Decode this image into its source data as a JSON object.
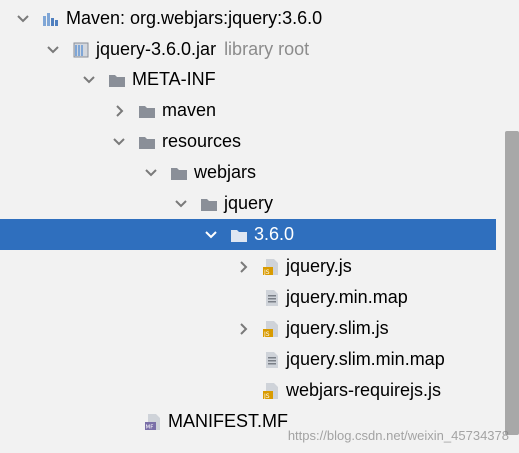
{
  "tree": {
    "items": [
      {
        "id": "maven-lib",
        "label": "Maven: org.webjars:jquery:3.6.0"
      },
      {
        "id": "jar",
        "label": "jquery-3.6.0.jar",
        "suffix": "library root"
      },
      {
        "id": "meta-inf",
        "label": "META-INF"
      },
      {
        "id": "maven-folder",
        "label": "maven"
      },
      {
        "id": "resources",
        "label": "resources"
      },
      {
        "id": "webjars",
        "label": "webjars"
      },
      {
        "id": "jquery-folder",
        "label": "jquery"
      },
      {
        "id": "version-folder",
        "label": "3.6.0"
      },
      {
        "id": "jquery-js",
        "label": "jquery.js"
      },
      {
        "id": "jquery-min-map",
        "label": "jquery.min.map"
      },
      {
        "id": "jquery-slim-js",
        "label": "jquery.slim.js"
      },
      {
        "id": "jquery-slim-min-map",
        "label": "jquery.slim.min.map"
      },
      {
        "id": "webjars-requirejs",
        "label": "webjars-requirejs.js"
      },
      {
        "id": "manifest",
        "label": "MANIFEST.MF"
      }
    ]
  },
  "watermark": "https://blog.csdn.net/weixin_45734378",
  "colors": {
    "selection": "#2f6fbe",
    "folder": "#8a8f98",
    "js_badge": "#d99b00",
    "library_root_text": "#8c8c8c"
  }
}
